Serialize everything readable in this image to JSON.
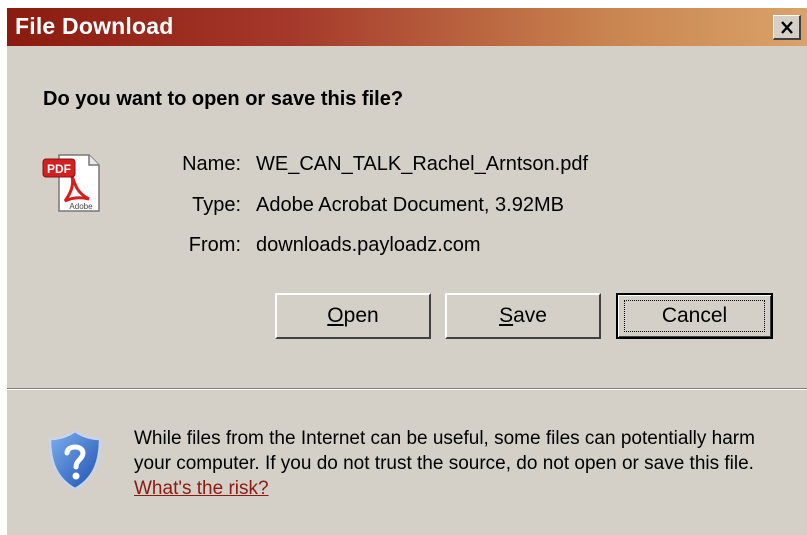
{
  "window": {
    "title": "File Download",
    "close_label": "X"
  },
  "prompt": {
    "question": "Do you want to open or save this file?"
  },
  "file": {
    "icon": "pdf-file-icon",
    "icon_badge": "PDF",
    "icon_caption": "Adobe",
    "fields": [
      {
        "label": "Name:",
        "value": "WE_CAN_TALK_Rachel_Arntson.pdf"
      },
      {
        "label": "Type:",
        "value": "Adobe Acrobat Document, 3.92MB"
      },
      {
        "label": "From:",
        "value": "downloads.payloadz.com"
      }
    ]
  },
  "buttons": {
    "open": {
      "mnemonic": "O",
      "rest": "pen"
    },
    "save": {
      "mnemonic": "S",
      "rest": "ave"
    },
    "cancel": {
      "label": "Cancel"
    }
  },
  "warning": {
    "icon": "security-shield-question-icon",
    "text": "While files from the Internet can be useful, some files can potentially harm your computer. If you do not trust the source, do not open or save this file.",
    "link_text": "What's the risk?"
  },
  "colors": {
    "titlebar_start": "#8c1b0f",
    "titlebar_end": "#d9a36a",
    "dialog_bg": "#d4d0c8",
    "link": "#8b1a10",
    "pdf_red": "#d21f1f",
    "shield_blue": "#2a63c9"
  }
}
